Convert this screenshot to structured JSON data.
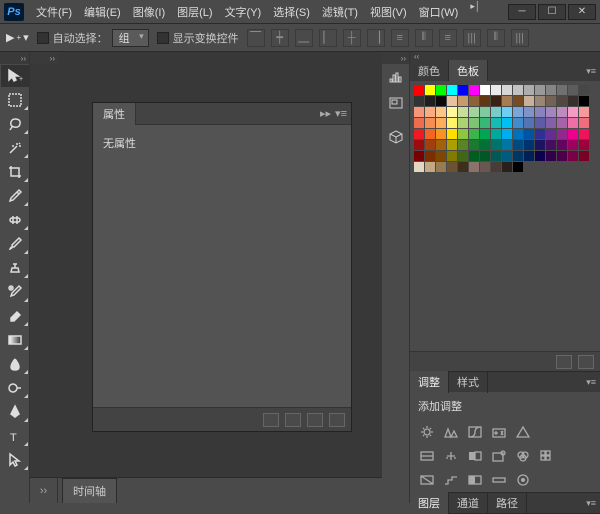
{
  "titlebar": {
    "logo": "Ps",
    "menus": [
      {
        "label": "文件(F)"
      },
      {
        "label": "编辑(E)"
      },
      {
        "label": "图像(I)"
      },
      {
        "label": "图层(L)"
      },
      {
        "label": "文字(Y)"
      },
      {
        "label": "选择(S)"
      },
      {
        "label": "滤镜(T)"
      },
      {
        "label": "视图(V)"
      },
      {
        "label": "窗口(W)"
      }
    ]
  },
  "options": {
    "autoSelectLabel": "自动选择：",
    "autoSelectValue": "组",
    "showTransformLabel": "显示变换控件"
  },
  "properties": {
    "tabLabel": "属性",
    "emptyText": "无属性"
  },
  "timeline": {
    "tabLabel": "时间轴"
  },
  "rightPanels": {
    "colorTab": "颜色",
    "swatchesTab": "色板",
    "adjustmentsTab": "调整",
    "stylesTab": "样式",
    "addAdjustmentLabel": "添加调整",
    "layersTab": "图层",
    "channelsTab": "通道",
    "pathsTab": "路径"
  },
  "swatches": [
    "#ff0000",
    "#ffff00",
    "#00ff00",
    "#00ffff",
    "#0000ff",
    "#ff00ff",
    "#ffffff",
    "#ebebeb",
    "#d6d6d6",
    "#c2c2c2",
    "#adadad",
    "#999999",
    "#858585",
    "#707070",
    "#5c5c5c",
    "#474747",
    "#333333",
    "#1f1f1f",
    "#0a0a0a",
    "#e8c19e",
    "#c69b6d",
    "#8c6239",
    "#603813",
    "#3b2313",
    "#a67c52",
    "#754c24",
    "#c7b299",
    "#998675",
    "#736357",
    "#534741",
    "#362f2d",
    "#000000",
    "#f7977a",
    "#fbad82",
    "#fdc689",
    "#fff799",
    "#c6df9c",
    "#a4d49d",
    "#81ca9d",
    "#7accc8",
    "#6dcff6",
    "#7ca6d8",
    "#8293ca",
    "#8882be",
    "#a286bd",
    "#bc8cbf",
    "#f49bc1",
    "#f5999d",
    "#f16c4d",
    "#f68e54",
    "#fbaf5a",
    "#fff467",
    "#acd372",
    "#7dc473",
    "#39b778",
    "#16bcb4",
    "#00bff3",
    "#438ccb",
    "#5573b7",
    "#5e5ca7",
    "#855fa8",
    "#a763a9",
    "#ef6ea8",
    "#f16d7e",
    "#ed1c24",
    "#f26522",
    "#f7941d",
    "#ffde00",
    "#8dc63f",
    "#39b54a",
    "#00a651",
    "#00a99d",
    "#00aeef",
    "#0072bc",
    "#0054a6",
    "#2e3192",
    "#662d91",
    "#92278f",
    "#ec008c",
    "#ed145b",
    "#9e0b0f",
    "#a0410d",
    "#a36209",
    "#aba000",
    "#598527",
    "#1a7b30",
    "#007236",
    "#00746b",
    "#0076a3",
    "#004a80",
    "#003471",
    "#1d1363",
    "#450e61",
    "#62055f",
    "#9e005d",
    "#9e0039",
    "#790000",
    "#7b2e00",
    "#7d4900",
    "#827b00",
    "#406618",
    "#005e20",
    "#005826",
    "#005952",
    "#005b7f",
    "#003663",
    "#002157",
    "#0d004c",
    "#32004b",
    "#4b0049",
    "#7b0046",
    "#7a0026",
    "#e3d7c1",
    "#c4a883",
    "#967b53",
    "#695333",
    "#3d2f1b",
    "#8c726b",
    "#6b5651",
    "#4a3b38",
    "#291f1c",
    "#000000"
  ]
}
